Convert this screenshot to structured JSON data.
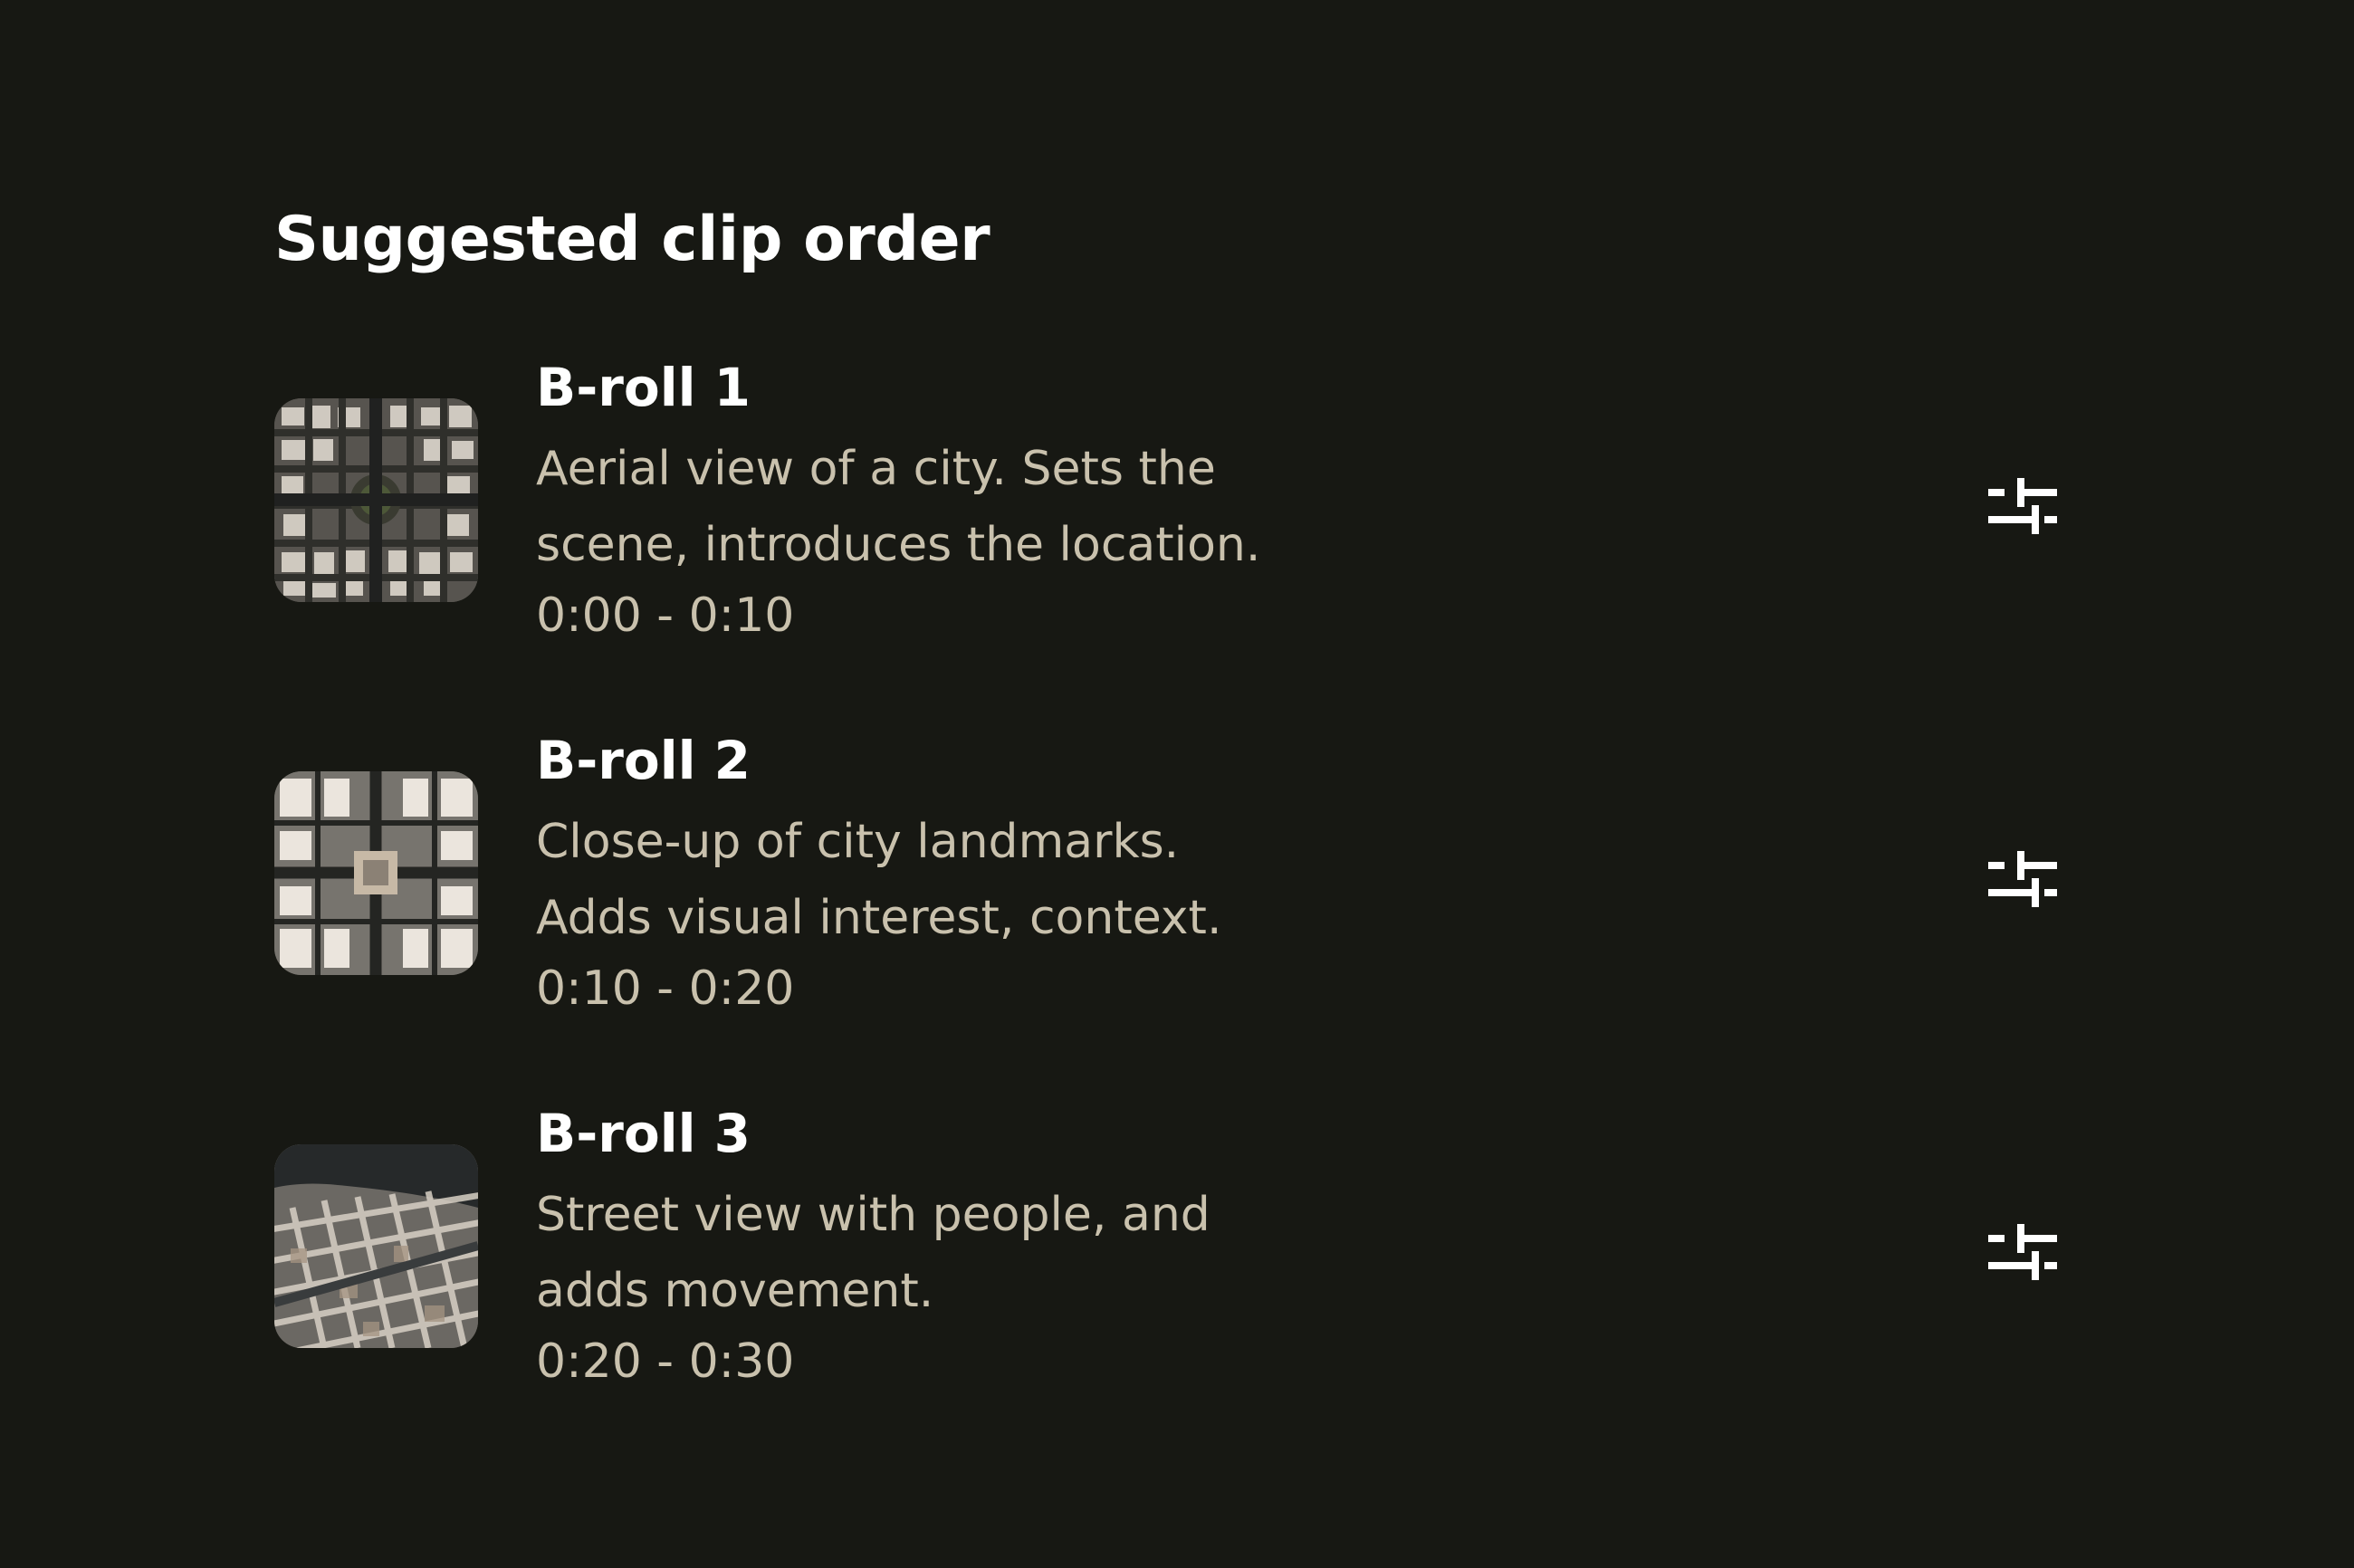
{
  "page": {
    "title": "Suggested clip order"
  },
  "clips": [
    {
      "title": "B-roll 1",
      "description_lines": [
        "Aerial view of a city. Sets the",
        "scene, introduces the location."
      ],
      "time_range": "0:00 - 0:10",
      "thumbnail_icon": "aerial-city-thumbnail",
      "action_icon": "sliders-icon"
    },
    {
      "title": "B-roll 2",
      "description_lines": [
        "Close-up of city landmarks.",
        "Adds visual interest, context."
      ],
      "time_range": "0:10 - 0:20",
      "thumbnail_icon": "city-landmarks-thumbnail",
      "action_icon": "sliders-icon"
    },
    {
      "title": "B-roll 3",
      "description_lines": [
        "Street view with people, and",
        "adds movement."
      ],
      "time_range": "0:20 - 0:30",
      "thumbnail_icon": "street-view-thumbnail",
      "action_icon": "sliders-icon"
    }
  ],
  "colors": {
    "background": "#171813",
    "primary_text": "#ffffff",
    "secondary_text": "#c9c1ad"
  }
}
